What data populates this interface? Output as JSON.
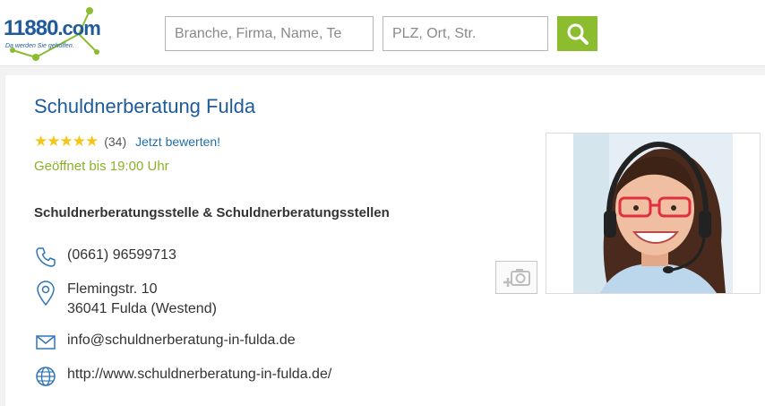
{
  "header": {
    "logo_text": "11880",
    "logo_suffix": ".com",
    "logo_tagline": "Da werden Sie geholfen.",
    "search_what_placeholder": "Branche, Firma, Name, Te",
    "search_where_placeholder": "PLZ, Ort, Str.",
    "search_icon": "magnifier-icon",
    "accent_color": "#8cbd2f",
    "brand_color": "#1f5a9b"
  },
  "listing": {
    "title": "Schuldnerberatung Fulda",
    "stars": "★★★★★",
    "rating_count": "(34)",
    "rate_link": "Jetzt bewerten!",
    "opening": "Geöffnet bis 19:00 Uhr",
    "category": "Schuldnerberatungsstelle & Schuldnerberatungsstellen",
    "phone": "(0661) 96599713",
    "street": "Flemingstr. 10",
    "city": "36041 Fulda (Westend)",
    "email": "info@schuldnerberatung-in-fulda.de",
    "website": "http://www.schuldnerberatung-in-fulda.de/",
    "icons": {
      "phone": "phone-icon",
      "address": "map-pin-icon",
      "email": "envelope-icon",
      "website": "globe-icon",
      "add_photo": "add-photo-icon"
    }
  }
}
